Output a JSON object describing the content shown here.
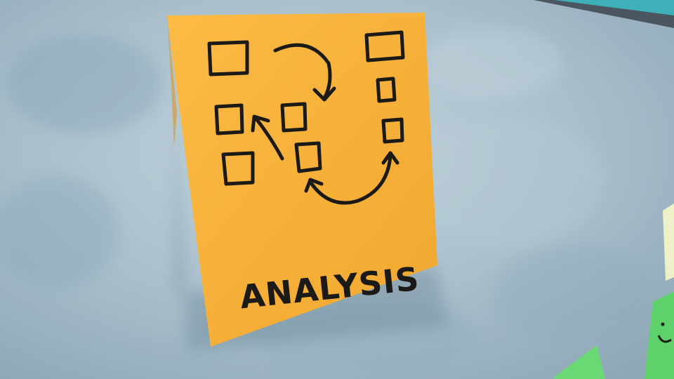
{
  "scene": {
    "description_free": true,
    "wall_color": "#a8bfcc",
    "wall_highlight": "#c9d8e0",
    "frame_color": "#5a6570",
    "teal_note_color": "#3fb0b8"
  },
  "sticky_note": {
    "color": "#f7b23b",
    "shadow_color": "#d18f22",
    "ink_color": "#1c1a16",
    "caption": "ANALYSIS"
  },
  "corner_notes": {
    "green_color": "#5fd16a",
    "pale_color": "#eef0c8"
  }
}
